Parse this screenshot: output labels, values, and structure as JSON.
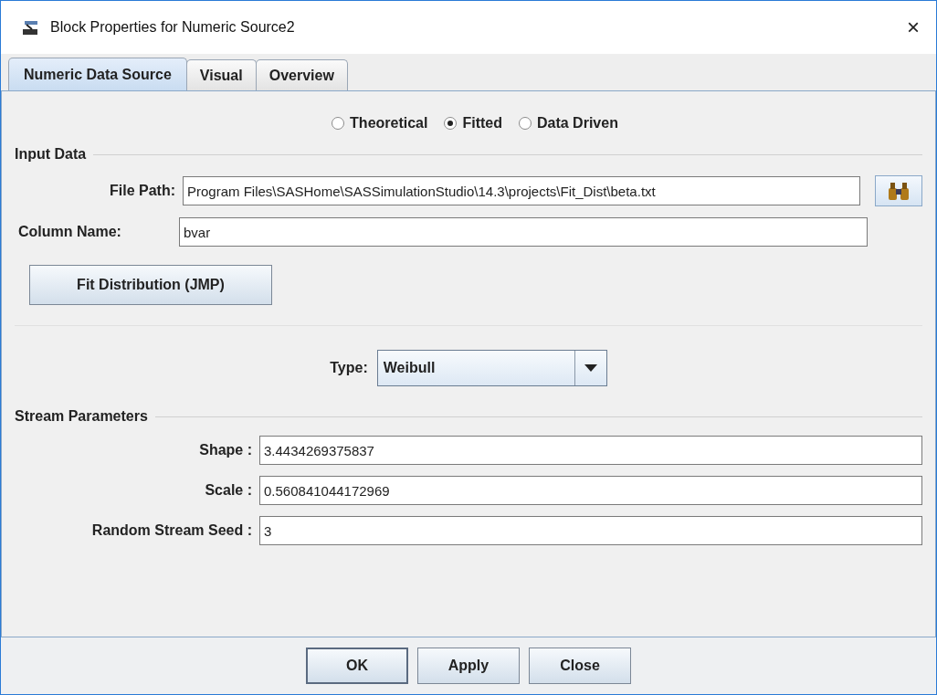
{
  "window": {
    "title": "Block Properties for Numeric Source2",
    "close": "×"
  },
  "tabs": [
    {
      "label": "Numeric Data Source",
      "selected": true
    },
    {
      "label": "Visual",
      "selected": false
    },
    {
      "label": "Overview",
      "selected": false
    }
  ],
  "mode_options": [
    {
      "label": "Theoretical",
      "selected": false
    },
    {
      "label": "Fitted",
      "selected": true
    },
    {
      "label": "Data Driven",
      "selected": false
    }
  ],
  "input_data": {
    "title": "Input Data",
    "file_path": {
      "label": "File Path:",
      "value": "Program Files\\SASHome\\SASSimulationStudio\\14.3\\projects\\Fit_Dist\\beta.txt"
    },
    "column_name": {
      "label": "Column Name:",
      "value": "bvar"
    },
    "fit_button": "Fit Distribution (JMP)"
  },
  "type": {
    "label": "Type:",
    "value": "Weibull"
  },
  "stream_parameters": {
    "title": "Stream Parameters",
    "fields": [
      {
        "label": "Shape :",
        "value": "3.4434269375837"
      },
      {
        "label": "Scale :",
        "value": "0.560841044172969"
      },
      {
        "label": "Random Stream Seed :",
        "value": "3"
      }
    ]
  },
  "buttons": [
    {
      "label": "OK",
      "default": true
    },
    {
      "label": "Apply",
      "default": false
    },
    {
      "label": "Close",
      "default": false
    }
  ]
}
